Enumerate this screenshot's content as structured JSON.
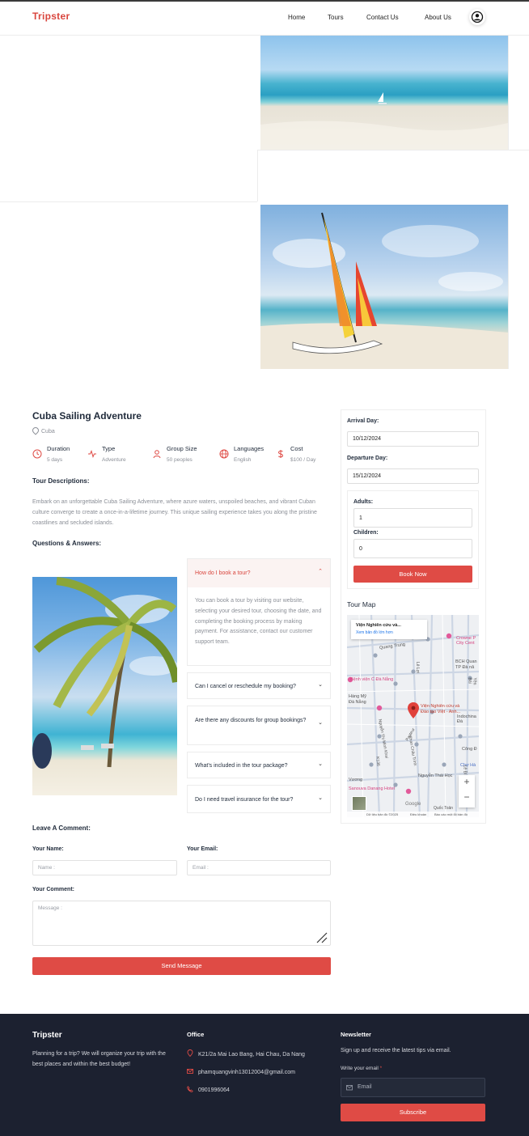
{
  "nav": {
    "logo": "Tripster",
    "links": [
      "Home",
      "Tours",
      "Contact Us",
      "About Us"
    ]
  },
  "tour": {
    "title": "Cuba Sailing Adventure",
    "location": "Cuba",
    "meta": [
      {
        "label": "Duration",
        "value": "5 days",
        "icon": "clock-icon"
      },
      {
        "label": "Type",
        "value": "Adventure",
        "icon": "activity-icon"
      },
      {
        "label": "Group Size",
        "value": "50 peoples",
        "icon": "user-icon"
      },
      {
        "label": "Languages",
        "value": "English",
        "icon": "globe-icon"
      },
      {
        "label": "Cost",
        "value": "$100 / Day",
        "icon": "dollar-icon"
      }
    ],
    "desc_heading": "Tour Descriptions:",
    "description": "Embark on an unforgettable Cuba Sailing Adventure, where azure waters, unspoiled beaches, and vibrant Cuban culture converge to create a once-in-a-lifetime journey. This unique sailing experience takes you along the pristine coastlines and secluded islands.",
    "qa_heading": "Questions & Answers:"
  },
  "faq": [
    {
      "q": "How do I book a tour?",
      "a": "You can book a tour by visiting our website, selecting your desired tour, choosing the date, and completing the booking process by making payment. For assistance, contact our customer support team.",
      "open": true
    },
    {
      "q": "Can I cancel or reschedule my booking?",
      "open": false
    },
    {
      "q": "Are there any discounts for group bookings?",
      "open": false
    },
    {
      "q": "What's included in the tour package?",
      "open": false
    },
    {
      "q": "Do I need travel insurance for the tour?",
      "open": false
    }
  ],
  "comment": {
    "heading": "Leave A Comment:",
    "name_label": "Your Name:",
    "name_placeholder": "Name :",
    "email_label": "Your Email:",
    "email_placeholder": "Email :",
    "comment_label": "Your Comment:",
    "message_placeholder": "Message :",
    "submit": "Send Message"
  },
  "booking": {
    "arrival_label": "Arrival Day:",
    "arrival_value": "10/12/2024",
    "departure_label": "Departure Day:",
    "departure_value": "15/12/2024",
    "adults_label": "Adults:",
    "adults_value": "1",
    "children_label": "Children:",
    "children_value": "0",
    "book_button": "Book Now",
    "map_heading": "Tour Map"
  },
  "map": {
    "place_title": "Viện Nghiên cứu và...",
    "larger_map_link": "Xem bản đồ lớn hơn",
    "labels": [
      "Crowne P",
      "City Cent",
      "Quang Trung",
      "BCH Quan",
      "TP Đà nă",
      "Bệnh viện C Đà Nẵng",
      "Viện Nghiên cứu và",
      "Đào tạo Việt - Anh...",
      "Lê Lợi",
      "Phan Châu Trinh",
      "Nguyễn Thị Minh Khai",
      "Pasteur",
      "Yên Bái",
      "Indochina Đà",
      "Nguyễn Thái Học",
      "Chợ Hà",
      "Sanouva Danang Hotel",
      "Công Đ",
      "K136",
      "Đà Nẵng",
      "Hàng Mỹ",
      "Quốc Toản",
      "Lê Đình Dương",
      "Vương"
    ],
    "zoom_in": "+",
    "zoom_out": "−",
    "footer_data": "Dữ liệu bản đồ ©2025",
    "footer_terms": "Điều khoản",
    "footer_report": "Báo cáo một lỗi bản đồ",
    "google": "Google"
  },
  "footer": {
    "brand": "Tripster",
    "about": "Planning for a trip? We will organize your trip with the best places and within the best budget!",
    "office_heading": "Office",
    "address": "K21/2a Mai Lao Bang, Hai Chau, Da Nang",
    "email": "phamquangvinh13012004@gmail.com",
    "phone": "0901996064",
    "newsletter_heading": "Newsletter",
    "newsletter_text": "Sign up and receive the latest tips via email.",
    "email_label": "Write your email",
    "required_mark": "*",
    "email_placeholder": "Email",
    "subscribe": "Subscribe"
  },
  "colors": {
    "accent": "#df4b45",
    "footer_bg": "#1c2130",
    "heading": "#1f2a3a",
    "muted": "#8b8f97"
  }
}
